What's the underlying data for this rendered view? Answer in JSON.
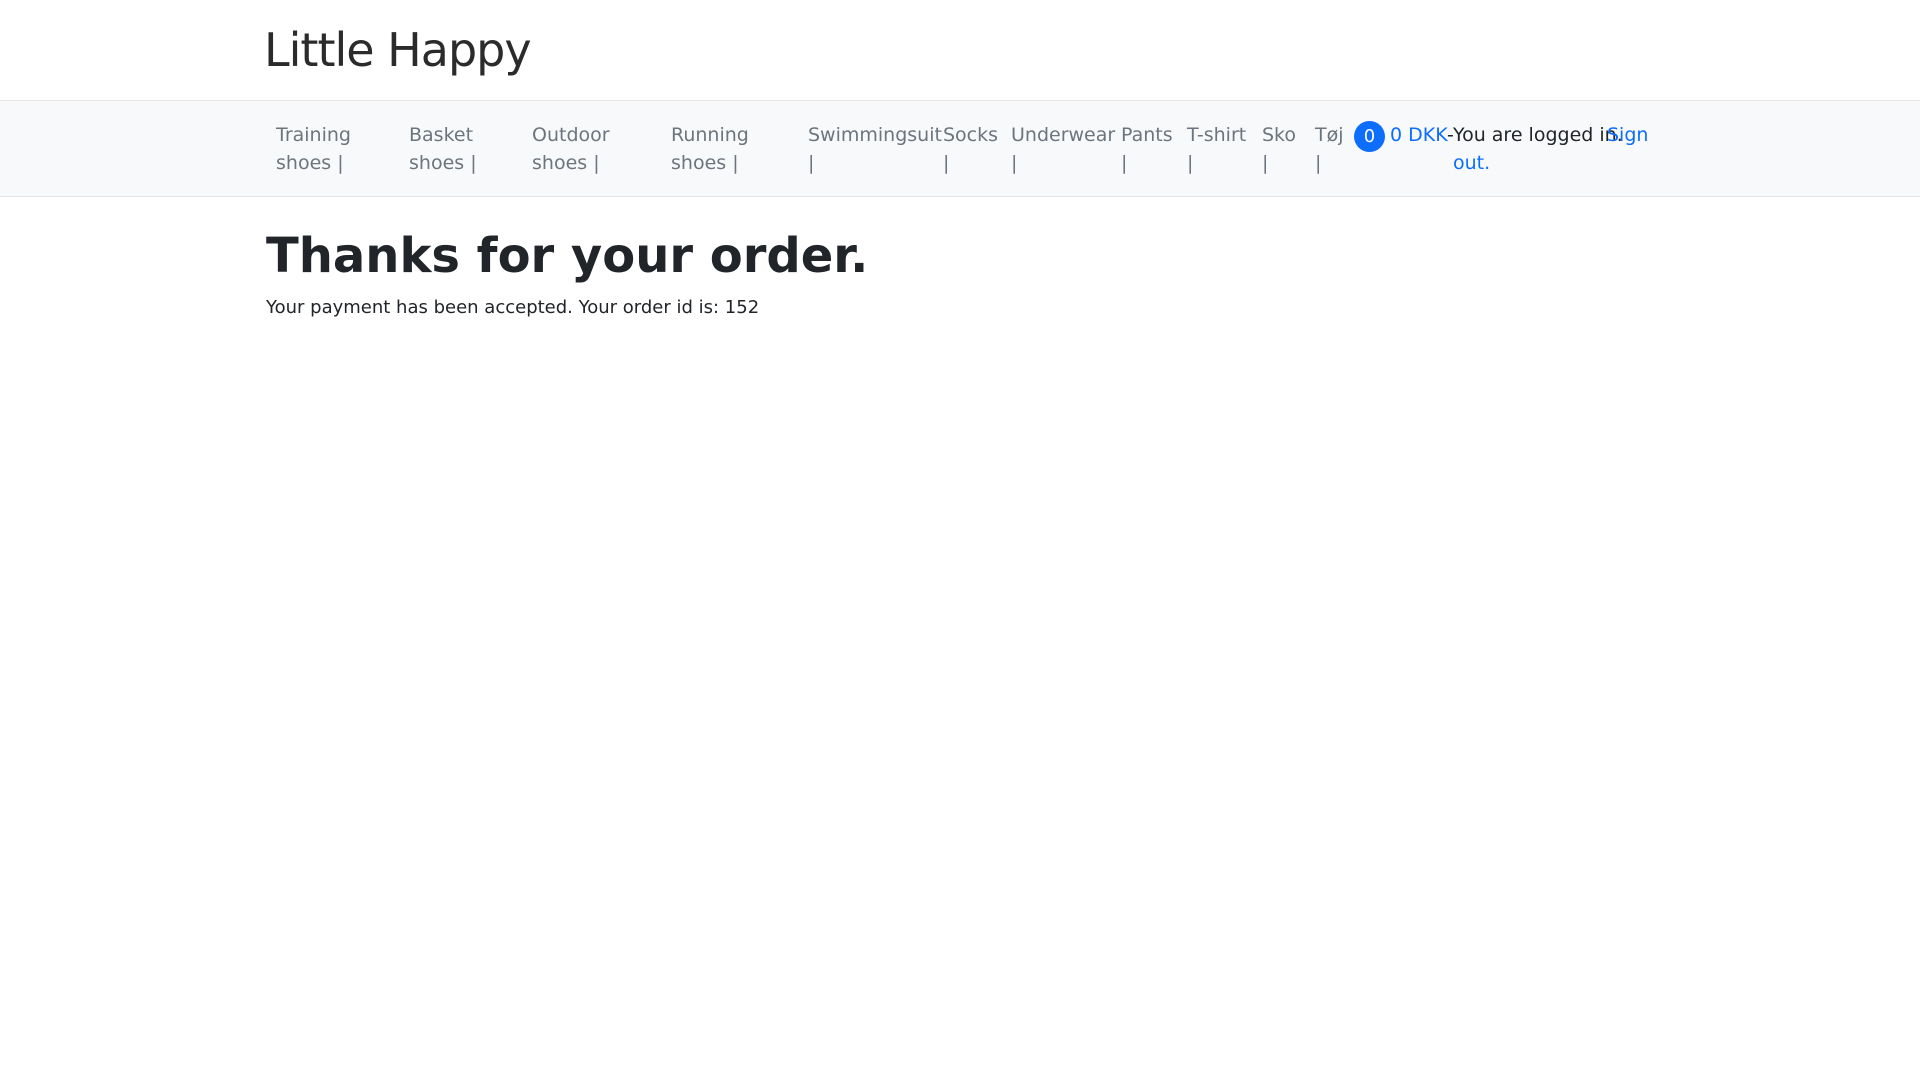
{
  "header": {
    "logo_text": "Little Happy"
  },
  "nav": {
    "items": [
      {
        "line1": "Training",
        "line2": "shoes |"
      },
      {
        "line1": "Basket",
        "line2": "shoes |"
      },
      {
        "line1": "Outdoor",
        "line2": "shoes |"
      },
      {
        "line1": "Running",
        "line2": "shoes |"
      },
      {
        "line1": "Swimmingsuit",
        "line2": "|"
      },
      {
        "line1": "Socks",
        "line2": "|"
      },
      {
        "line1": "Underwear",
        "line2": "|"
      },
      {
        "line1": "Pants",
        "line2": "|"
      },
      {
        "line1": "T-shirt",
        "line2": "|"
      },
      {
        "line1": "Sko",
        "line2": "|"
      },
      {
        "line1": "Tøj",
        "line2": "|"
      }
    ]
  },
  "cart": {
    "count": "0",
    "total": "0 DKK"
  },
  "account": {
    "dash": "-",
    "status_text": "You are logged in.",
    "signout_part1": "Sign",
    "signout_part2": "out."
  },
  "main": {
    "title": "Thanks for your order.",
    "message": "Your payment has been accepted. Your order id is: 152"
  },
  "colors": {
    "accent": "#0d6efd",
    "navbar_bg": "#f8f9fa",
    "nav_text": "#6c757d",
    "text": "#212529"
  }
}
